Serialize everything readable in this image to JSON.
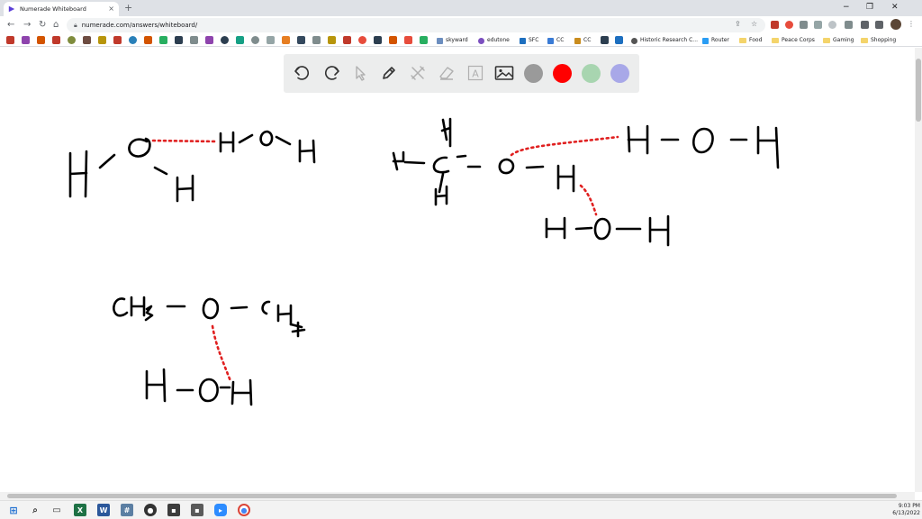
{
  "browser": {
    "tab_title": "Numerade Whiteboard",
    "tab_close": "×",
    "new_tab": "+",
    "url": "numerade.com/answers/whiteboard/",
    "window_controls": [
      "−",
      "❐",
      "✕"
    ]
  },
  "bookmarks": [
    {
      "label": "skyward",
      "color": "#6c8ebf"
    },
    {
      "label": "edutone",
      "color": "#7b4fbf"
    },
    {
      "label": "SFC",
      "color": "#1d6fbf"
    },
    {
      "label": "CC",
      "color": "#3a7bd5"
    },
    {
      "label": "CC",
      "color": "#c98c1d"
    },
    {
      "label": "Historic Research C...",
      "color": "#555555"
    },
    {
      "label": "Router",
      "color": "#2a9df4"
    },
    {
      "label": "Food",
      "color": "folder"
    },
    {
      "label": "Peace Corps",
      "color": "folder"
    },
    {
      "label": "Gaming",
      "color": "folder"
    },
    {
      "label": "Shopping",
      "color": "folder"
    }
  ],
  "whiteboard": {
    "tools": [
      "undo-icon",
      "redo-icon",
      "pointer-icon",
      "pen-icon",
      "tools-icon",
      "eraser-icon",
      "text-icon",
      "image-icon"
    ],
    "text_tool_label": "A",
    "colors": [
      "#9a9a9a",
      "#ff0000",
      "#a8d5b0",
      "#a8a8e8"
    ],
    "ink_color": "#000000",
    "dash_color": "#e02020"
  },
  "taskbar": {
    "time": "9:03 PM",
    "date": "6/13/2022"
  }
}
